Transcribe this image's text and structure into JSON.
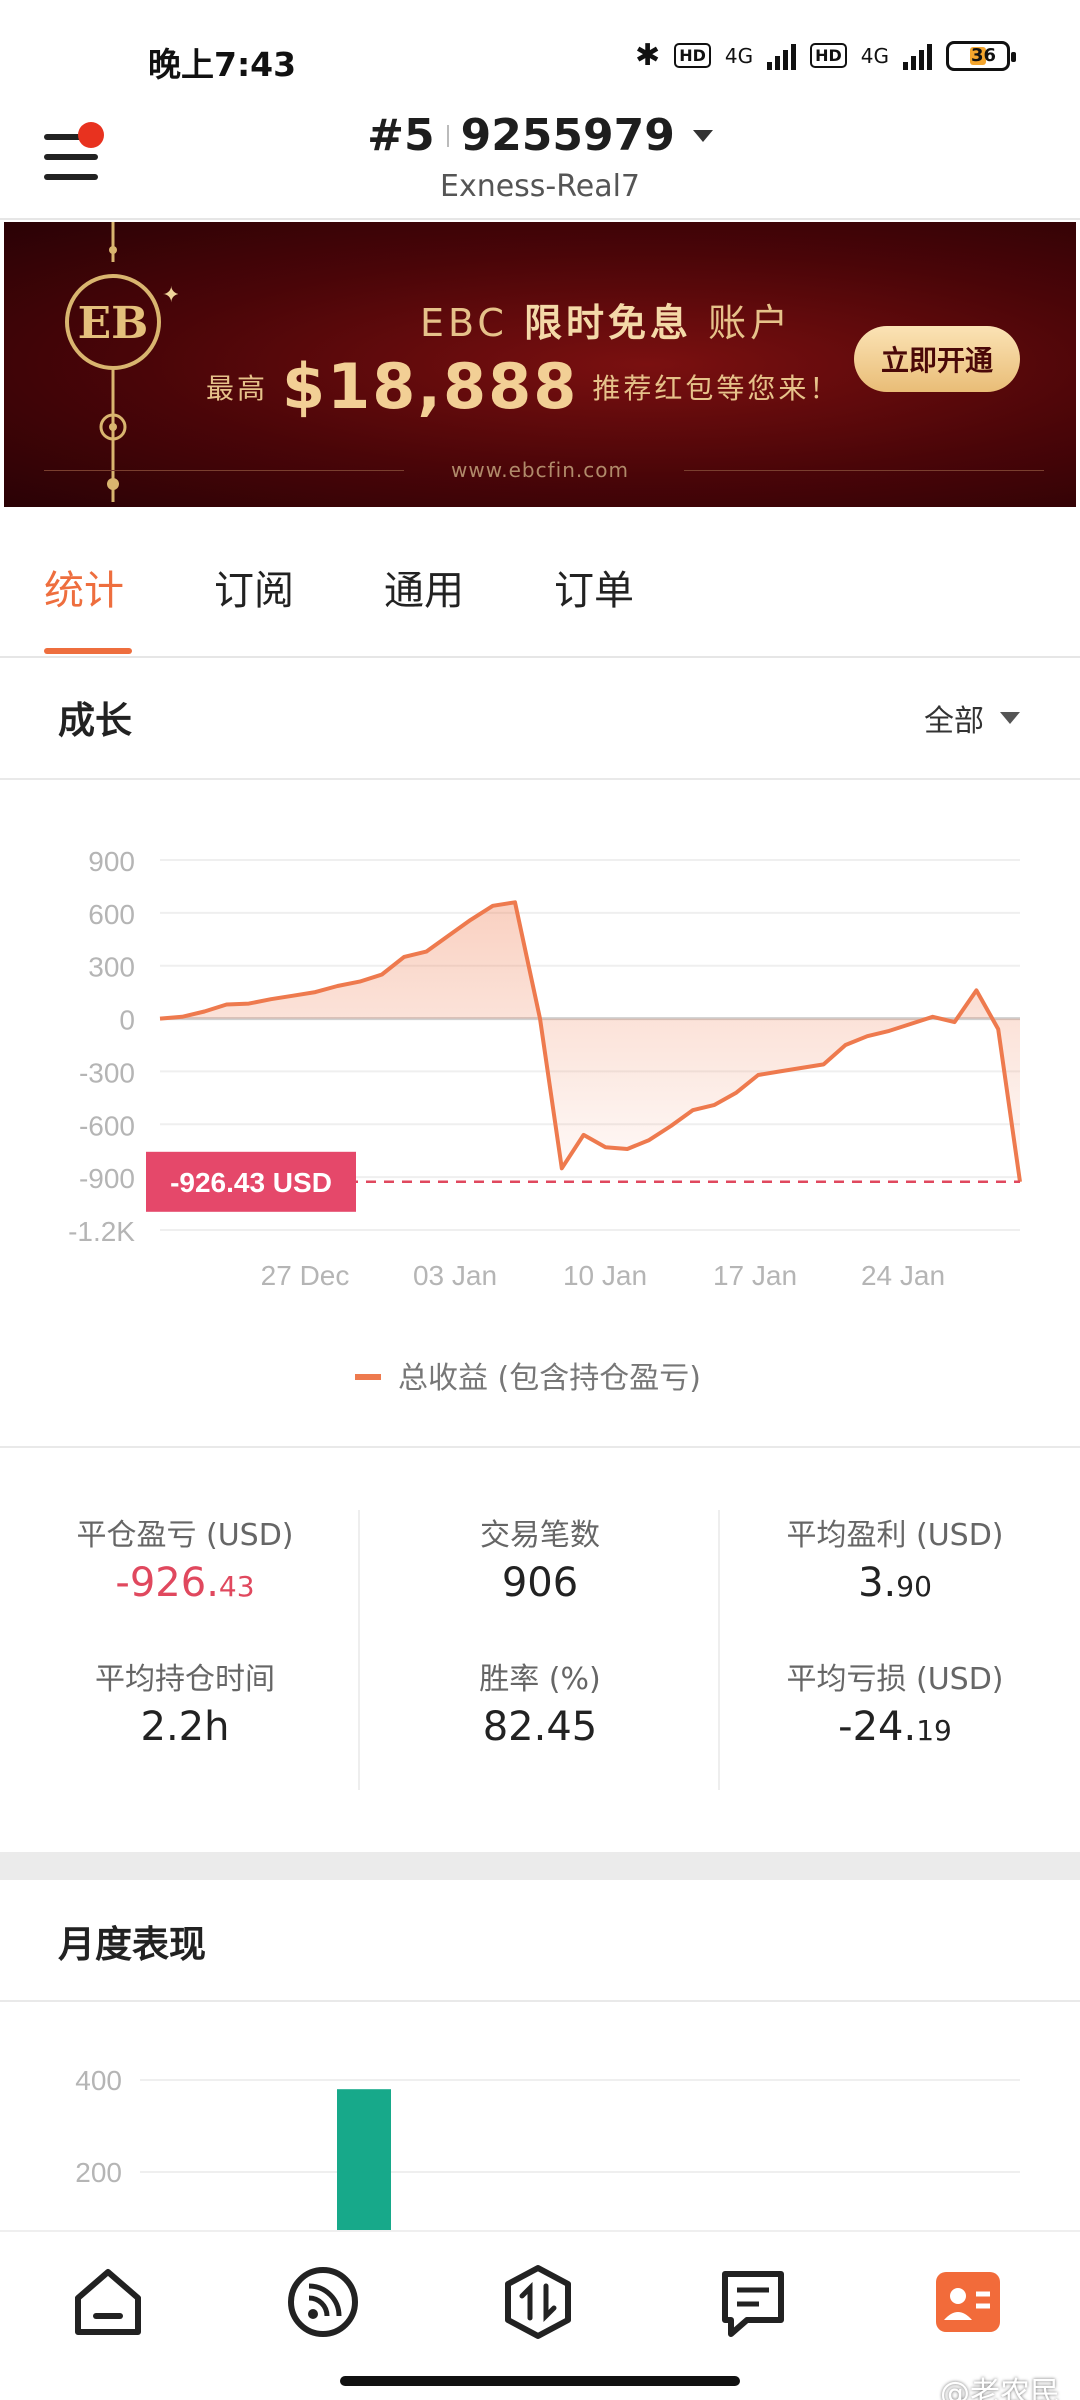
{
  "status_bar": {
    "time": "晚上7:43",
    "hd1": "HD",
    "net1": "4G",
    "hd2": "HD",
    "net2": "4G",
    "battery": "36"
  },
  "header": {
    "account_index": "#5",
    "account_number": "9255979",
    "server": "Exness-Real7"
  },
  "banner": {
    "brand": "EBC",
    "headline_highlight": "限时免息",
    "headline_suffix": "账户",
    "prefix": "最高",
    "amount": "$18,888",
    "suffix": "推荐红包等您来！",
    "button": "立即开通",
    "url": "www.ebcfin.com"
  },
  "tabs": [
    {
      "label": "统计",
      "active": true
    },
    {
      "label": "订阅",
      "active": false
    },
    {
      "label": "通用",
      "active": false
    },
    {
      "label": "订单",
      "active": false
    }
  ],
  "growth": {
    "title": "成长",
    "filter": "全部"
  },
  "chart_data": [
    {
      "type": "area",
      "ylim": [
        -1200,
        900
      ],
      "yticks": [
        "900",
        "600",
        "300",
        "0",
        "-300",
        "-600",
        "-900",
        "-1.2K"
      ],
      "ytick_values": [
        900,
        600,
        300,
        0,
        -300,
        -600,
        -900,
        -1200
      ],
      "xticks": [
        "27 Dec",
        "03 Jan",
        "10 Jan",
        "17 Jan",
        "24 Jan"
      ],
      "series": [
        {
          "name": "总收益 (包含持仓盈亏)",
          "color": "#ee7a4e",
          "values": [
            0,
            10,
            40,
            80,
            85,
            110,
            130,
            150,
            185,
            210,
            250,
            350,
            380,
            470,
            560,
            640,
            660,
            0,
            -850,
            -660,
            -730,
            -740,
            -690,
            -610,
            -520,
            -490,
            -420,
            -320,
            -300,
            -280,
            -260,
            -150,
            -100,
            -70,
            -30,
            10,
            -20,
            160,
            -60,
            -926.43
          ]
        }
      ],
      "current_value_label": "-926.43 USD",
      "current_value": -926.43
    },
    {
      "type": "bar",
      "yticks": [
        "400",
        "200"
      ],
      "ytick_values": [
        400,
        200
      ],
      "series": [
        {
          "values": [
            380
          ],
          "color": "#17a98a"
        }
      ]
    }
  ],
  "stats": {
    "closed_pnl": {
      "label": "平仓盈亏 (USD)",
      "int": "-926.",
      "dec": "43"
    },
    "trades": {
      "label": "交易笔数",
      "value": "906"
    },
    "avg_profit": {
      "label": "平均盈利 (USD)",
      "int": "3.",
      "dec": "90"
    },
    "avg_hold": {
      "label": "平均持仓时间",
      "value": "2.2h"
    },
    "win_rate": {
      "label": "胜率 (%)",
      "value": "82.45"
    },
    "avg_loss": {
      "label": "平均亏损 (USD)",
      "int": "-24.",
      "dec": "19"
    }
  },
  "monthly": {
    "title": "月度表现"
  },
  "nav": [
    "home-icon",
    "feed-icon",
    "trade-icon",
    "news-icon",
    "profile-icon"
  ],
  "watermark": "@老农民"
}
